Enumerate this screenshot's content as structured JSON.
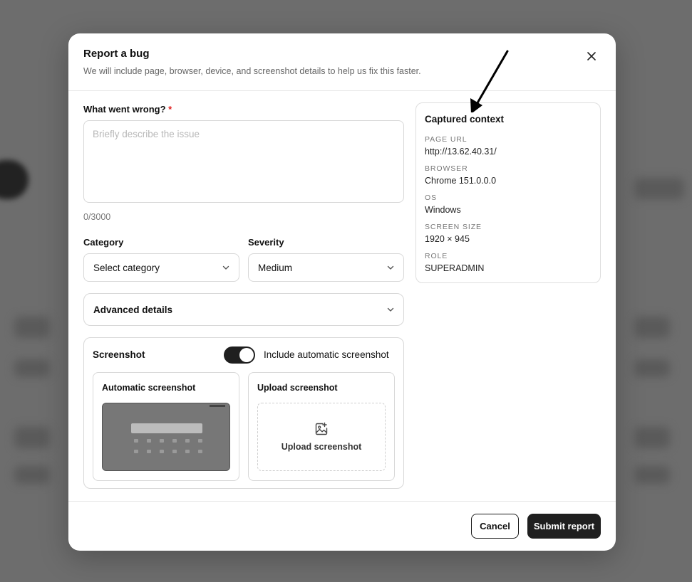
{
  "modal": {
    "title": "Report a bug",
    "subtitle": "We will include page, browser, device, and screenshot details to help us fix this faster."
  },
  "form": {
    "what_label": "What went wrong?",
    "required_mark": "*",
    "description_placeholder": "Briefly describe the issue",
    "description_value": "",
    "counter": "0/3000",
    "category_label": "Category",
    "category_value": "Select category",
    "severity_label": "Severity",
    "severity_value": "Medium",
    "advanced_label": "Advanced details"
  },
  "screenshot": {
    "title": "Screenshot",
    "toggle_label": "Include automatic screenshot",
    "toggle_on": true,
    "auto_title": "Automatic screenshot",
    "upload_title": "Upload screenshot",
    "upload_button": "Upload screenshot"
  },
  "context": {
    "title": "Captured context",
    "items": [
      {
        "key": "PAGE URL",
        "value": "http://13.62.40.31/"
      },
      {
        "key": "BROWSER",
        "value": "Chrome 151.0.0.0"
      },
      {
        "key": "OS",
        "value": "Windows"
      },
      {
        "key": "SCREEN SIZE",
        "value": "1920 × 945"
      },
      {
        "key": "ROLE",
        "value": "SUPERADMIN"
      }
    ]
  },
  "footer": {
    "cancel_label": "Cancel",
    "submit_label": "Submit report"
  },
  "colors": {
    "overlay": "#6b6b6b",
    "primary": "#1f1f1f",
    "required": "#e02424"
  }
}
